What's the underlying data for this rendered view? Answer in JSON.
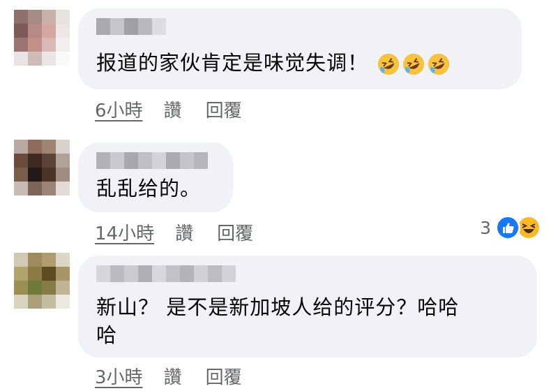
{
  "comments": [
    {
      "text": "报道的家伙肯定是味觉失调！",
      "emoji": [
        "rofl-emoji",
        "rofl-emoji",
        "rofl-emoji"
      ],
      "time": "6小時",
      "like": "讚",
      "reply": "回覆"
    },
    {
      "text": "乱乱给的。",
      "time": "14小時",
      "like": "讚",
      "reply": "回覆",
      "reaction_count": "3",
      "reaction_icons": [
        "like-reaction-icon",
        "haha-reaction-icon"
      ]
    },
    {
      "text_line1": "新山？ 是不是新加坡人给的评分？哈哈",
      "text_line2": "哈",
      "time": "3小時",
      "like": "讚",
      "reply": "回覆"
    }
  ],
  "colors": {
    "bubble": "#f0f2f5",
    "meta_text": "#65676b",
    "like_blue": "#1877f2",
    "haha_yellow": "#f7b928"
  }
}
